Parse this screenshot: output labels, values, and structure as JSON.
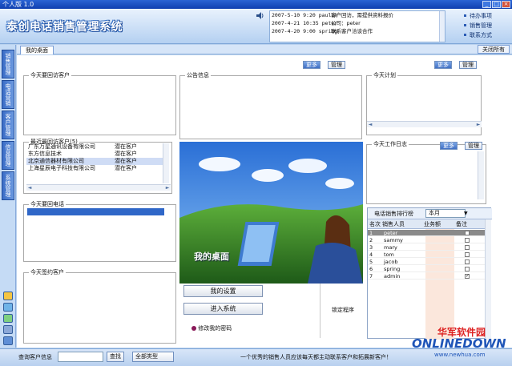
{
  "window": {
    "title": "个人版 1.0",
    "buttons": [
      "_",
      "□",
      "×"
    ]
  },
  "app": {
    "name": "泰创电话销售管理系统"
  },
  "reminders": [
    {
      "time": "2007-5-10 9:20 paulin",
      "text": "客户回访，需提供资料报价"
    },
    {
      "time": "2007-4-21 10:35 peter",
      "text": "公司：peter"
    },
    {
      "time": "2007-4-20 9:00 spring",
      "text": "联系客户洽谈合作"
    }
  ],
  "header_links": [
    "待办事项",
    "销售管理",
    "联系方式"
  ],
  "left_nav": [
    "销售管理",
    "电话营销",
    "客户管理",
    "信息管理",
    "系统管理"
  ],
  "tabbar": {
    "tab": "我的桌面",
    "close_all": "关闭所有"
  },
  "panels": {
    "visit": {
      "legend": "今天要回访客户"
    },
    "notice": {
      "legend": "公告信息",
      "btn_more": "更多",
      "btn_manage": "管理"
    },
    "plan": {
      "legend": "今天计划",
      "btn_more": "更多",
      "btn_manage": "管理"
    },
    "recent": {
      "legend": "最近最回访客户(5)",
      "rows": [
        {
          "name": "广东万星通讯设备有限公司",
          "type": "潜在客户"
        },
        {
          "name": "东方信息技术",
          "type": "潜在客户"
        },
        {
          "name": "北京通信器材有限公司",
          "type": "潜在客户"
        },
        {
          "name": "上海星辰电子科技有限公司",
          "type": "潜在客户"
        }
      ]
    },
    "callback": {
      "legend": "今天要回电话"
    },
    "sign": {
      "legend": "今天签约客户"
    },
    "work": {
      "legend": "今天工作日志",
      "btn_more": "更多",
      "btn_manage": "管理"
    }
  },
  "desktop": {
    "caption": "我的桌面"
  },
  "buttons": {
    "set_desktop": "我的设置",
    "open": "进入系统",
    "change_pw": "修改我的密码",
    "lock": "锁定程序"
  },
  "ranking": {
    "title": "电话销售排行榜",
    "period": "本月",
    "columns": [
      "名次",
      "销售人员",
      "业务额",
      "备注"
    ],
    "rows": [
      {
        "no": "1",
        "name": "peter",
        "check": ""
      },
      {
        "no": "2",
        "name": "sammy",
        "check": ""
      },
      {
        "no": "3",
        "name": "mary",
        "check": ""
      },
      {
        "no": "4",
        "name": "tom",
        "check": ""
      },
      {
        "no": "5",
        "name": "jacob",
        "check": ""
      },
      {
        "no": "6",
        "name": "spring",
        "check": ""
      },
      {
        "no": "7",
        "name": "admin",
        "check": "✓"
      }
    ]
  },
  "status": {
    "search_label": "查询客户信息",
    "search_value": "",
    "search_btn": "查找",
    "select_btn": "全部类型",
    "message": "一个优秀的销售人员应该每天都主动联系客户和拓展新客户！"
  },
  "watermark": {
    "cn": "华军软件园",
    "en": "ONLINEDOWN",
    "url": "www.newhua.com"
  },
  "colors": {
    "titlebar": "#1d4fc0",
    "header": "#b4d0f1",
    "nav": "#3a6cc6"
  }
}
